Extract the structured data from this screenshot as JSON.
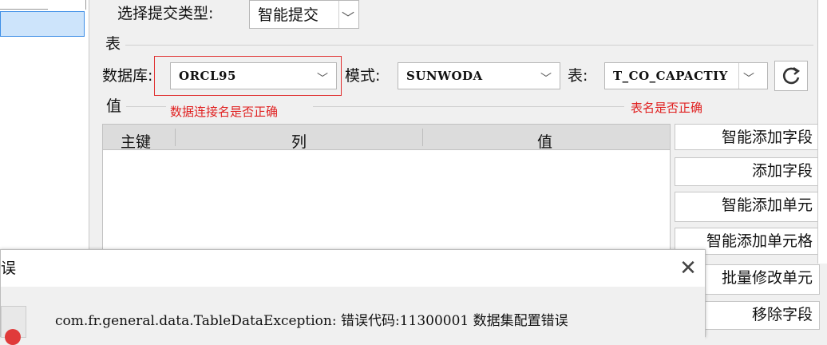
{
  "submit": {
    "label": "选择提交类型:",
    "value": "智能提交"
  },
  "section_table": "表",
  "database": {
    "label": "数据库:",
    "value": "ORCL95"
  },
  "schema": {
    "label": "模式:",
    "value": "SUNWODA"
  },
  "table": {
    "label": "表:",
    "value": "T_CO_CAPACTIY"
  },
  "section_value": "值",
  "annotations": {
    "db_hint": "数据连接名是否正确",
    "table_hint": "表名是否正确"
  },
  "grid": {
    "columns": [
      "主键",
      "列",
      "值"
    ]
  },
  "side_buttons": [
    "智能添加字段",
    "添加字段",
    "智能添加单元",
    "智能添加单元格",
    "批量修改单元",
    "移除字段"
  ],
  "dialog": {
    "title": "误",
    "message": "com.fr.general.data.TableDataException: 错误代码:11300001 数据集配置错误"
  },
  "colors": {
    "annotation": "#e02020",
    "selection": "#cde4fb",
    "highlight_box": "#e03030"
  },
  "icons": [
    "chevron-down-icon",
    "refresh-icon",
    "close-icon",
    "error-icon"
  ]
}
